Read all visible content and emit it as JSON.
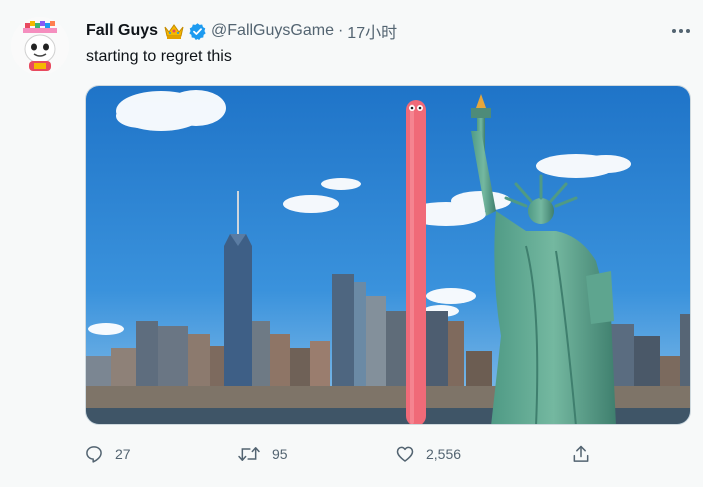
{
  "tweet": {
    "author_name": "Fall Guys",
    "author_handle": "@FallGuysGame",
    "separator": "·",
    "time": "17小时",
    "text": "starting to regret this",
    "icons": {
      "crown": "crown-icon",
      "verified": "verified-badge-icon",
      "more": "more-dots-icon"
    },
    "image_alt": "Fall Guys character stretched tall between the New York skyline and the Statue of Liberty",
    "actions": {
      "replies": "27",
      "retweets": "95",
      "likes": "2,556"
    },
    "colors": {
      "verified": "#1d9bf0",
      "crown": "#f5b800",
      "bean": "#f06a78",
      "sky": "#2f86d6"
    }
  }
}
